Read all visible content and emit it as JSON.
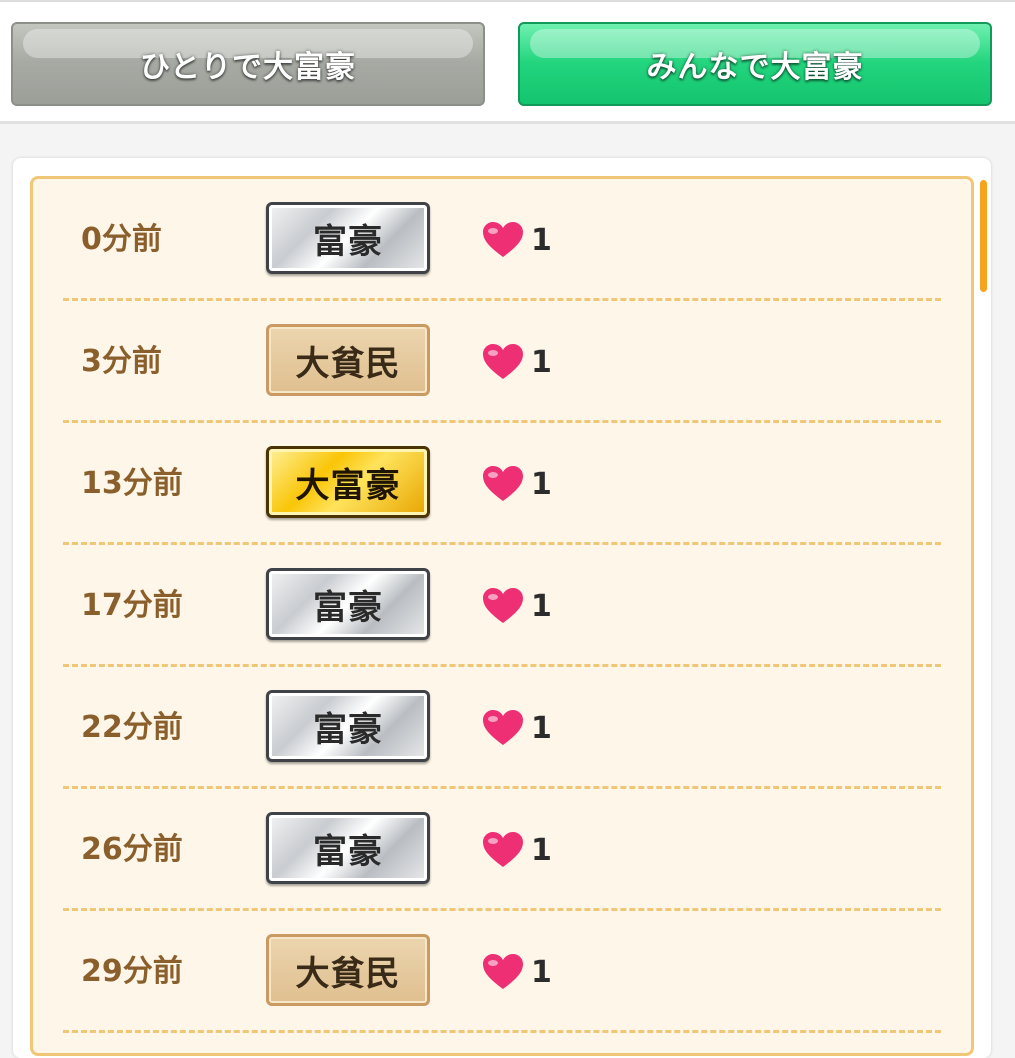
{
  "tabs": {
    "solo_label": "ひとりで大富豪",
    "multi_label": "みんなで大富豪"
  },
  "colors": {
    "active_tab": "#23d57e",
    "inactive_tab": "#a6aaa3",
    "panel_bg": "#fef6e8",
    "panel_border": "#efc777",
    "time_text": "#8a5f2c",
    "heart": "#ee2f73"
  },
  "history": [
    {
      "time": "0分前",
      "rank": "富豪",
      "rank_style": "silver",
      "icon": "heart-icon",
      "likes": "1"
    },
    {
      "time": "3分前",
      "rank": "大貧民",
      "rank_style": "bronze",
      "icon": "heart-icon",
      "likes": "1"
    },
    {
      "time": "13分前",
      "rank": "大富豪",
      "rank_style": "gold",
      "icon": "heart-icon",
      "likes": "1"
    },
    {
      "time": "17分前",
      "rank": "富豪",
      "rank_style": "silver",
      "icon": "heart-icon",
      "likes": "1"
    },
    {
      "time": "22分前",
      "rank": "富豪",
      "rank_style": "silver",
      "icon": "heart-icon",
      "likes": "1"
    },
    {
      "time": "26分前",
      "rank": "富豪",
      "rank_style": "silver",
      "icon": "heart-icon",
      "likes": "1"
    },
    {
      "time": "29分前",
      "rank": "大貧民",
      "rank_style": "bronze",
      "icon": "heart-icon",
      "likes": "1"
    }
  ]
}
